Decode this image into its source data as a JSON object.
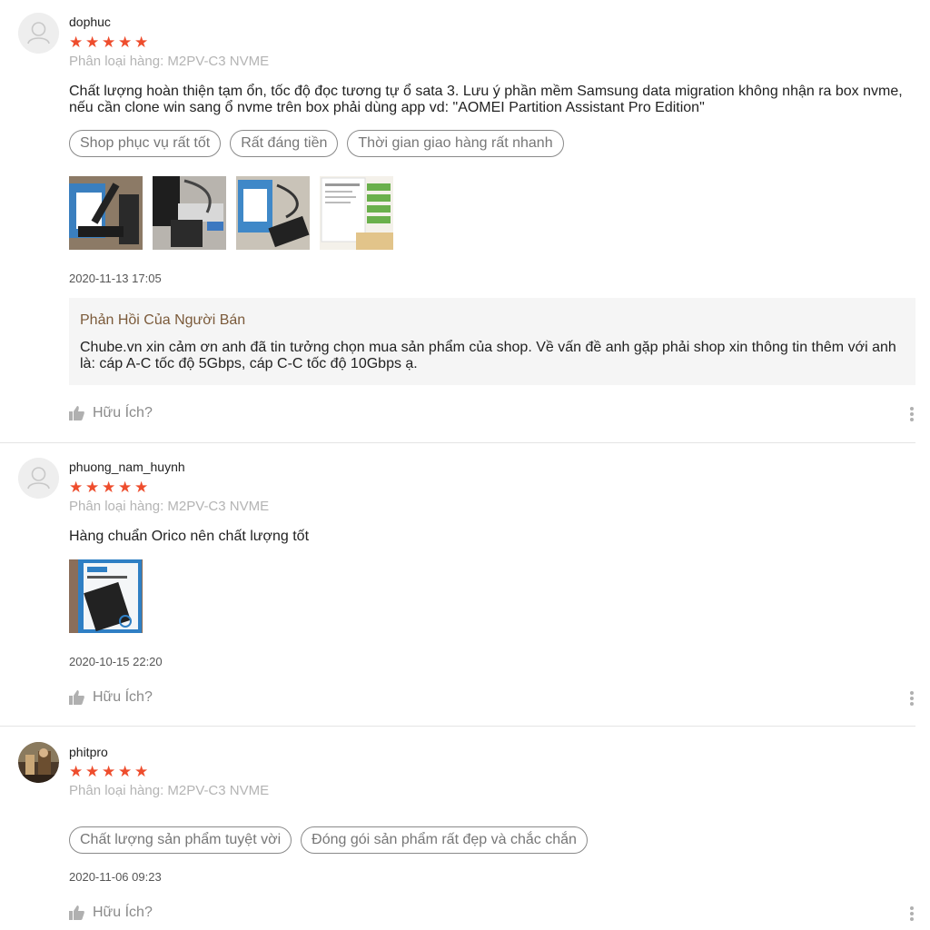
{
  "reviews": [
    {
      "username": "dophuc",
      "rating": 5,
      "variant": "Phân loại hàng: M2PV-C3 NVME",
      "comment": "Chất lượng hoàn thiện tạm ổn, tốc độ đọc tương tự ổ sata 3. Lưu ý phần mềm Samsung data migration không nhận ra box nvme, nếu cần clone win sang ổ nvme trên box phải dùng app vd: \"AOMEI Partition Assistant Pro Edition\"",
      "tags": [
        "Shop phục vụ rất tốt",
        "Rất đáng tiền",
        "Thời gian giao hàng rất nhanh"
      ],
      "photos": [
        "product-photo-1",
        "product-photo-2",
        "product-photo-3",
        "benchmark-screenshot"
      ],
      "date": "2020-11-13 17:05",
      "seller_reply": {
        "title": "Phản Hồi Của Người Bán",
        "text": "Chube.vn xin cảm ơn anh đã tin tưởng chọn mua sản phẩm của shop. Về vấn đề anh gặp phải shop xin thông tin thêm với anh là: cáp A-C tốc độ 5Gbps, cáp C-C tốc độ 10Gbps ạ."
      },
      "helpful_label": "Hữu Ích?"
    },
    {
      "username": "phuong_nam_huynh",
      "rating": 5,
      "variant": "Phân loại hàng: M2PV-C3 NVME",
      "comment": "Hàng chuẩn Orico nên chất lượng tốt",
      "photos": [
        "orico-box-photo"
      ],
      "date": "2020-10-15 22:20",
      "helpful_label": "Hữu Ích?"
    },
    {
      "username": "phitpro",
      "rating": 5,
      "variant": "Phân loại hàng: M2PV-C3 NVME",
      "tags": [
        "Chất lượng sản phẩm tuyệt vời",
        "Đóng gói sản phẩm rất đẹp và chắc chắn"
      ],
      "date": "2020-11-06 09:23",
      "helpful_label": "Hữu Ích?"
    }
  ],
  "icons": {
    "star": "star-icon",
    "thumb": "thumbs-up-icon",
    "more": "more-vertical-icon",
    "avatar": "default-avatar-icon"
  },
  "colors": {
    "star": "#ee4d2d",
    "seller_title": "#7b5a3a",
    "muted": "#b4b4b4"
  }
}
